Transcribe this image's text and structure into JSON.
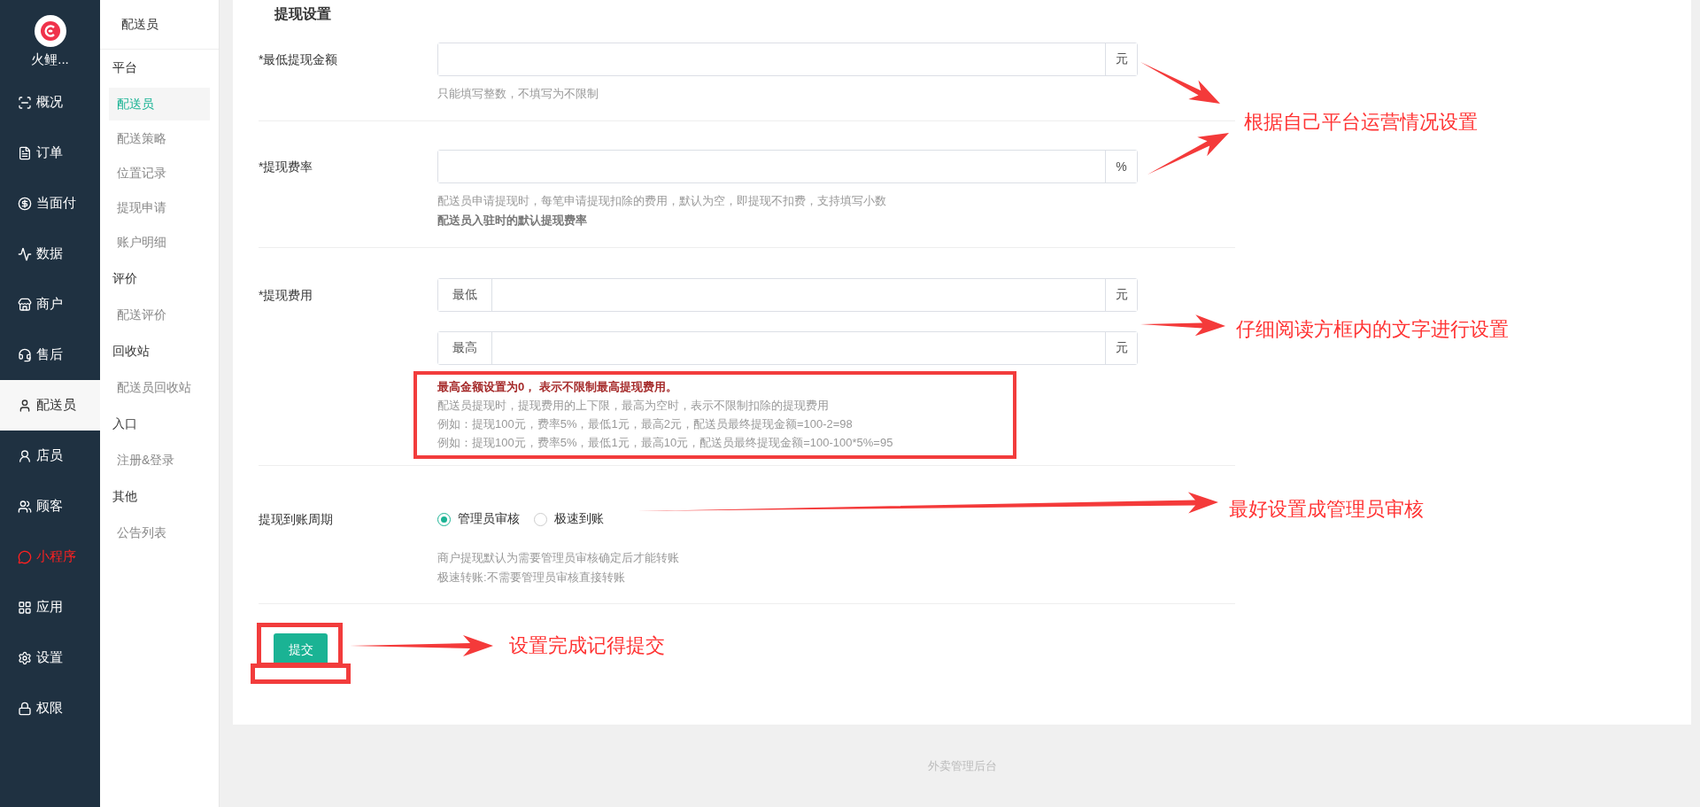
{
  "app": {
    "name": "火鲤..."
  },
  "nav": [
    {
      "label": "概况",
      "selected": false,
      "highlighted": false
    },
    {
      "label": "订单",
      "selected": false,
      "highlighted": false
    },
    {
      "label": "当面付",
      "selected": false,
      "highlighted": false
    },
    {
      "label": "数据",
      "selected": false,
      "highlighted": false
    },
    {
      "label": "商户",
      "selected": false,
      "highlighted": false
    },
    {
      "label": "售后",
      "selected": false,
      "highlighted": false
    },
    {
      "label": "配送员",
      "selected": true,
      "highlighted": false
    },
    {
      "label": "店员",
      "selected": false,
      "highlighted": false
    },
    {
      "label": "顾客",
      "selected": false,
      "highlighted": false
    },
    {
      "label": "小程序",
      "selected": false,
      "highlighted": true
    },
    {
      "label": "应用",
      "selected": false,
      "highlighted": false
    },
    {
      "label": "设置",
      "selected": false,
      "highlighted": false
    },
    {
      "label": "权限",
      "selected": false,
      "highlighted": false
    }
  ],
  "subnav": {
    "title": "配送员",
    "groups": [
      {
        "label": "平台",
        "items": [
          {
            "label": "配送员",
            "selected": true
          },
          {
            "label": "配送策略",
            "selected": false
          },
          {
            "label": "位置记录",
            "selected": false
          },
          {
            "label": "提现申请",
            "selected": false
          },
          {
            "label": "账户明细",
            "selected": false
          }
        ]
      },
      {
        "label": "评价",
        "items": [
          {
            "label": "配送评价",
            "selected": false
          }
        ]
      },
      {
        "label": "回收站",
        "items": [
          {
            "label": "配送员回收站",
            "selected": false
          }
        ]
      },
      {
        "label": "入口",
        "items": [
          {
            "label": "注册&登录",
            "selected": false
          }
        ]
      },
      {
        "label": "其他",
        "items": [
          {
            "label": "公告列表",
            "selected": false
          }
        ]
      }
    ]
  },
  "section_title": "提现设置",
  "fields": [
    {
      "kind": "input",
      "label": "*最低提现金额",
      "boxed": false,
      "inputs": [
        {
          "suffix": "元"
        }
      ],
      "hints": [
        {
          "text": "只能填写整数，不填写为不限制",
          "kind": "plain"
        }
      ]
    },
    {
      "kind": "input",
      "label": "*提现费率",
      "boxed": false,
      "inputs": [
        {
          "suffix": "%"
        }
      ],
      "hints": [
        {
          "text": "配送员申请提现时，每笔申请提现扣除的费用，默认为空，即提现不扣费，支持填写小数",
          "kind": "plain"
        },
        {
          "text": "配送员入驻时的默认提现费率",
          "kind": "strong"
        }
      ]
    },
    {
      "kind": "input",
      "label": "*提现费用",
      "boxed": true,
      "inputs": [
        {
          "prefix": "最低",
          "suffix": "元"
        },
        {
          "prefix": "最高",
          "suffix": "元"
        }
      ],
      "hints": [
        {
          "text": "最高金额设置为0， 表示不限制最高提现费用。",
          "kind": "warning"
        },
        {
          "text": "配送员提现时，提现费用的上下限，最高为空时，表示不限制扣除的提现费用",
          "kind": "plain"
        },
        {
          "text": "例如：提现100元，费率5%，最低1元，最高2元，配送员最终提现金额=100-2=98",
          "kind": "plain"
        },
        {
          "text": "例如：提现100元，费率5%，最低1元，最高10元，配送员最终提现金额=100-100*5%=95",
          "kind": "plain"
        }
      ]
    },
    {
      "kind": "radio",
      "label": "提现到账周期",
      "boxed": false,
      "options": [
        {
          "label": "管理员审核",
          "selected": true
        },
        {
          "label": "极速到账",
          "selected": false
        }
      ],
      "hints": [
        {
          "text": "商户提现默认为需要管理员审核确定后才能转账",
          "kind": "plain"
        },
        {
          "text": "极速转账:不需要管理员审核直接转账",
          "kind": "plain"
        }
      ]
    }
  ],
  "submit": {
    "label": "提交"
  },
  "annotations": [
    "根据自己平台运营情况设置",
    "仔细阅读方框内的文字进行设置",
    "最好设置成管理员审核",
    "设置完成记得提交"
  ],
  "footer": "外卖管理后台"
}
